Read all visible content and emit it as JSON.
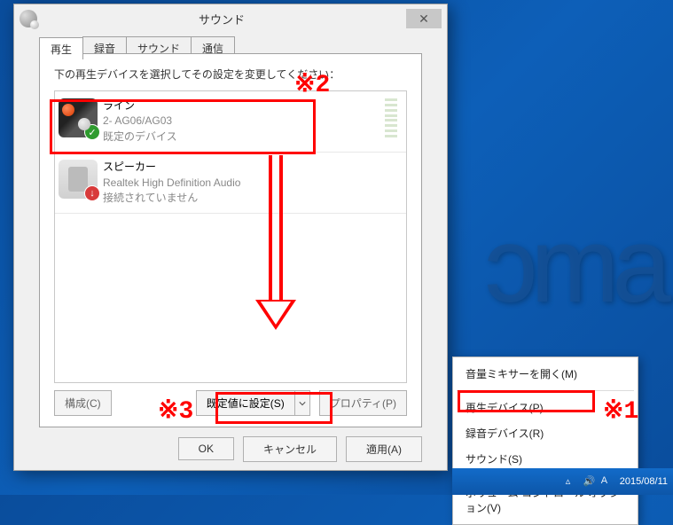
{
  "dialog": {
    "title": "サウンド",
    "close": "✕",
    "tabs": [
      "再生",
      "録音",
      "サウンド",
      "通信"
    ],
    "instruction": "下の再生デバイスを選択してその設定を変更してください：",
    "devices": [
      {
        "name": "ライン",
        "sub1": "2- AG06/AG03",
        "sub2": "既定のデバイス"
      },
      {
        "name": "スピーカー",
        "sub1": "Realtek High Definition Audio",
        "sub2": "接続されていません"
      }
    ],
    "btn_configure": "構成(C)",
    "btn_set_default": "既定値に設定(S)",
    "btn_properties": "プロパティ(P)",
    "footer": {
      "ok": "OK",
      "cancel": "キャンセル",
      "apply": "適用(A)"
    }
  },
  "annotations": {
    "a1": "※1",
    "a2": "※2",
    "a3": "※3"
  },
  "context_menu": {
    "items": [
      "音量ミキサーを開く(M)",
      "再生デバイス(P)",
      "録音デバイス(R)",
      "サウンド(S)",
      "ボリューム コントロール オプション(V)"
    ]
  },
  "taskbar": {
    "date": "2015/08/11"
  },
  "bg_brand": "ɔma"
}
